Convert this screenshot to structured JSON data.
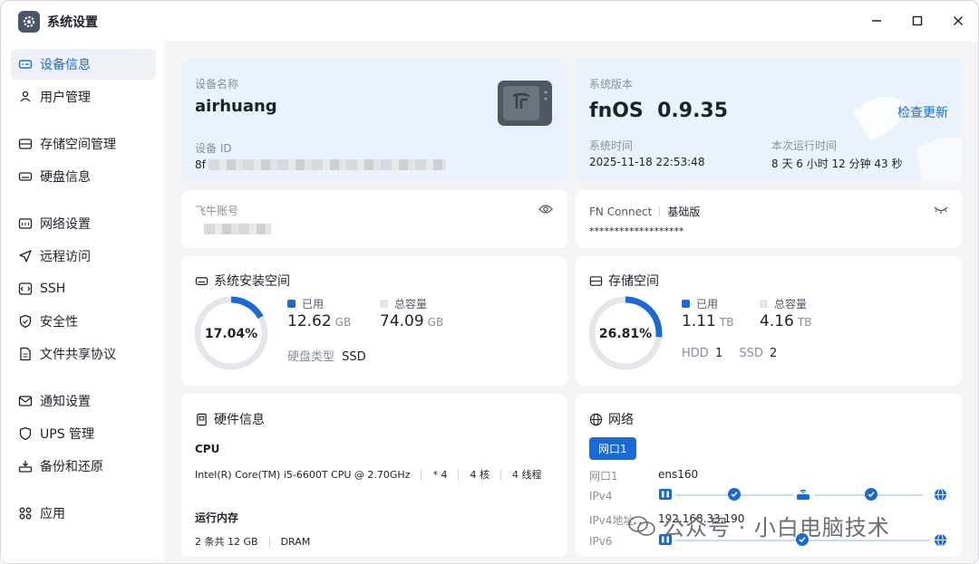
{
  "window": {
    "title": "系统设置"
  },
  "sidebar": {
    "items": [
      {
        "label": "设备信息",
        "icon": "device-icon",
        "active": true
      },
      {
        "label": "用户管理",
        "icon": "users-icon"
      },
      {
        "label": "存储空间管理",
        "icon": "storage-icon"
      },
      {
        "label": "硬盘信息",
        "icon": "disk-icon"
      },
      {
        "label": "网络设置",
        "icon": "network-icon"
      },
      {
        "label": "远程访问",
        "icon": "send-icon"
      },
      {
        "label": "SSH",
        "icon": "ssh-icon"
      },
      {
        "label": "安全性",
        "icon": "shield-icon"
      },
      {
        "label": "文件共享协议",
        "icon": "file-icon"
      },
      {
        "label": "通知设置",
        "icon": "mail-icon"
      },
      {
        "label": "UPS 管理",
        "icon": "ups-shield-icon"
      },
      {
        "label": "备份和还原",
        "icon": "backup-icon"
      },
      {
        "label": "应用",
        "icon": "apps-icon"
      }
    ]
  },
  "device": {
    "name_label": "设备名称",
    "name": "airhuang",
    "id_label": "设备 ID",
    "id_prefix": "8f"
  },
  "system": {
    "version_label": "系统版本",
    "version": "fnOS  0.9.35",
    "check_update": "检查更新",
    "time_label": "系统时间",
    "time": "2025-11-18 22:53:48",
    "uptime_label": "本次运行时间",
    "uptime": "8 天 6 小时 12 分钟 43 秒"
  },
  "account": {
    "label": "飞牛账号"
  },
  "fnconnect": {
    "label": "FN Connect",
    "tier": "基础版",
    "masked": "*******************"
  },
  "sys_space": {
    "title": "系统安装空间",
    "percent": 17.04,
    "percent_text": "17.04%",
    "used_label": "已用",
    "used": "12.62",
    "used_unit": "GB",
    "total_label": "总容量",
    "total": "74.09",
    "total_unit": "GB",
    "disk_type_label": "硬盘类型",
    "disk_type": "SSD"
  },
  "storage": {
    "title": "存储空间",
    "percent": 26.81,
    "percent_text": "26.81%",
    "used_label": "已用",
    "used": "1.11",
    "used_unit": "TB",
    "total_label": "总容量",
    "total": "4.16",
    "total_unit": "TB",
    "hdd_label": "HDD",
    "hdd": "1",
    "ssd_label": "SSD",
    "ssd": "2"
  },
  "hardware": {
    "title": "硬件信息",
    "cpu_label": "CPU",
    "cpu_model": "Intel(R) Core(TM) i5-6600T CPU @ 2.70GHz",
    "cpu_count": "* 4",
    "cores": "4 核",
    "threads": "4 线程",
    "mem_label": "运行内存",
    "mem_size": "2 条共 12 GB",
    "mem_type": "DRAM"
  },
  "network": {
    "title": "网络",
    "tab": "网口1",
    "port_label": "网口1",
    "port": "ens160",
    "ipv4_label": "IPv4",
    "ipv4_addr_label": "IPv4地址",
    "ipv4_addr": "192.168.33.190",
    "ipv6_label": "IPv6"
  },
  "watermark": {
    "text": "公众号 · 小白电脑技术"
  },
  "colors": {
    "accent": "#1a6ad6",
    "ring_bg": "#e5e6eb"
  }
}
